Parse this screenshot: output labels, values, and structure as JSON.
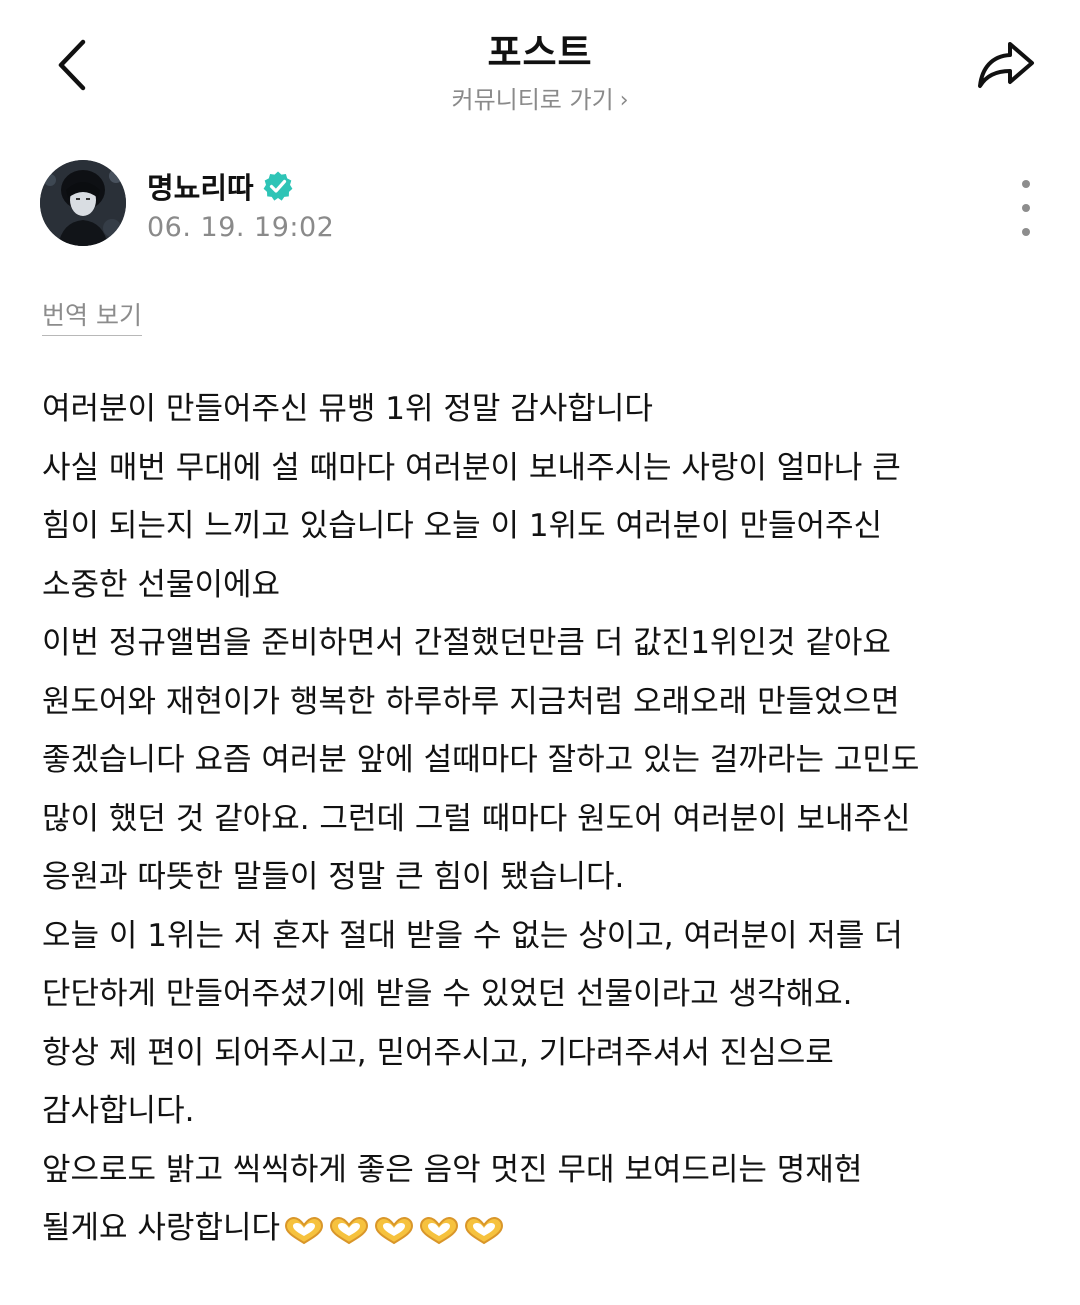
{
  "header": {
    "title": "포스트",
    "community_link": "커뮤니티로 가기",
    "back_icon": "chevron-left-icon",
    "share_icon": "share-arrow-icon"
  },
  "author": {
    "name": "명뇨리따",
    "date": "06. 19. 19:02",
    "verified_color": "#2ec4b6",
    "more_icon": "more-vertical-icon"
  },
  "translate_label": "번역 보기",
  "post": {
    "lines": [
      "여러분이 만들어주신 뮤뱅 1위 정말 감사합니다",
      "사실 매번 무대에 설 때마다 여러분이 보내주시는 사랑이 얼마나 큰",
      "힘이 되는지 느끼고 있습니다 오늘 이 1위도 여러분이 만들어주신",
      "소중한 선물이에요",
      "이번 정규앨범을 준비하면서 간절했던만큼 더 값진1위인것 같아요",
      "원도어와 재현이가 행복한 하루하루 지금처럼 오래오래 만들었으면",
      "좋겠습니다 요즘 여러분 앞에 설때마다 잘하고 있는 걸까라는 고민도",
      "많이 했던 것 같아요. 그런데 그럴 때마다 원도어 여러분이 보내주신",
      "응원과 따뜻한 말들이 정말 큰 힘이 됐습니다.",
      "오늘 이 1위는 저 혼자 절대 받을 수 없는 상이고, 여러분이 저를 더",
      "단단하게 만들어주셨기에 받을 수 있었던 선물이라고 생각해요.",
      "항상 제 편이 되어주시고, 믿어주시고, 기다려주셔서 진심으로",
      "감사합니다.",
      "앞으로도 밝고 씩씩하게 좋은 음악 멋진 무대 보여드리는 명재현"
    ],
    "last_line": "될게요 사랑합니다",
    "emoji_icon": "heart-hands-icon",
    "emoji_count": 5
  },
  "colors": {
    "muted_text": "#8a8a8a",
    "body_text": "#121212"
  }
}
